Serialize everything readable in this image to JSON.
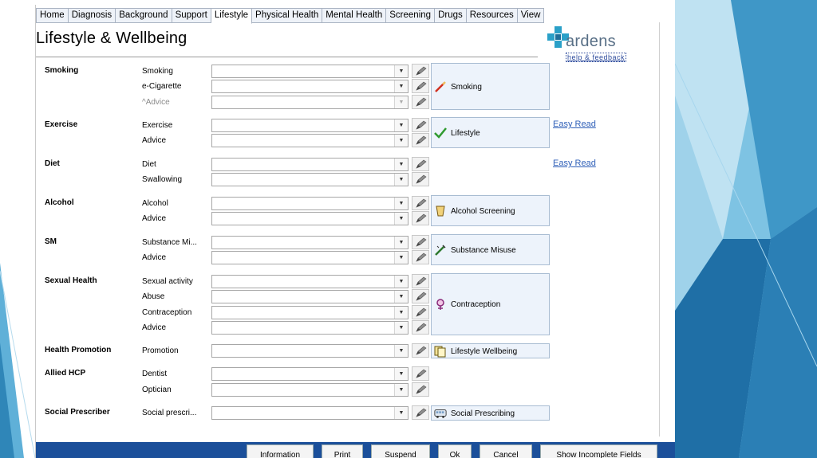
{
  "tabs": [
    "Home",
    "Diagnosis",
    "Background",
    "Support",
    "Lifestyle",
    "Physical Health",
    "Mental Health",
    "Screening",
    "Drugs",
    "Resources",
    "View"
  ],
  "active_tab": "Lifestyle",
  "page_title": "Lifestyle & Wellbeing",
  "logo": {
    "text": "ardens",
    "link": "help & feedback"
  },
  "sections": {
    "smoking": {
      "label": "Smoking",
      "fields": [
        "Smoking",
        "e-Cigarette",
        "^Advice"
      ],
      "panel": "Smoking"
    },
    "exercise": {
      "label": "Exercise",
      "fields": [
        "Exercise",
        "Advice"
      ],
      "panel": "Lifestyle",
      "easy_read": "Easy Read"
    },
    "diet": {
      "label": "Diet",
      "fields": [
        "Diet",
        "Swallowing"
      ],
      "easy_read": "Easy Read"
    },
    "alcohol": {
      "label": "Alcohol",
      "fields": [
        "Alcohol",
        "Advice"
      ],
      "panel": "Alcohol Screening"
    },
    "sm": {
      "label": "SM",
      "fields": [
        "Substance Mi...",
        "Advice"
      ],
      "panel": "Substance Misuse"
    },
    "sexual_health": {
      "label": "Sexual Health",
      "fields": [
        "Sexual activity",
        "Abuse",
        "Contraception",
        "Advice"
      ],
      "panel": "Contraception"
    },
    "health_promotion": {
      "label": "Health Promotion",
      "fields": [
        "Promotion"
      ],
      "panel": "Lifestyle Wellbeing"
    },
    "allied_hcp": {
      "label": "Allied HCP",
      "fields": [
        "Dentist",
        "Optician"
      ]
    },
    "social_prescriber": {
      "label": "Social Prescriber",
      "fields": [
        "Social prescri..."
      ],
      "panel": "Social Prescribing"
    }
  },
  "buttons": [
    "Information",
    "Print",
    "Suspend",
    "Ok",
    "Cancel",
    "Show Incomplete Fields"
  ],
  "colors": {
    "accent": "#1b4f9a",
    "panel_bg": "#edf3fb",
    "link": "#3060b8",
    "logo": "#586f86",
    "logo_cross": "#2aa0c8"
  },
  "icons": {
    "pen": "pencil-icon",
    "combo": "chevron-down-icon"
  }
}
